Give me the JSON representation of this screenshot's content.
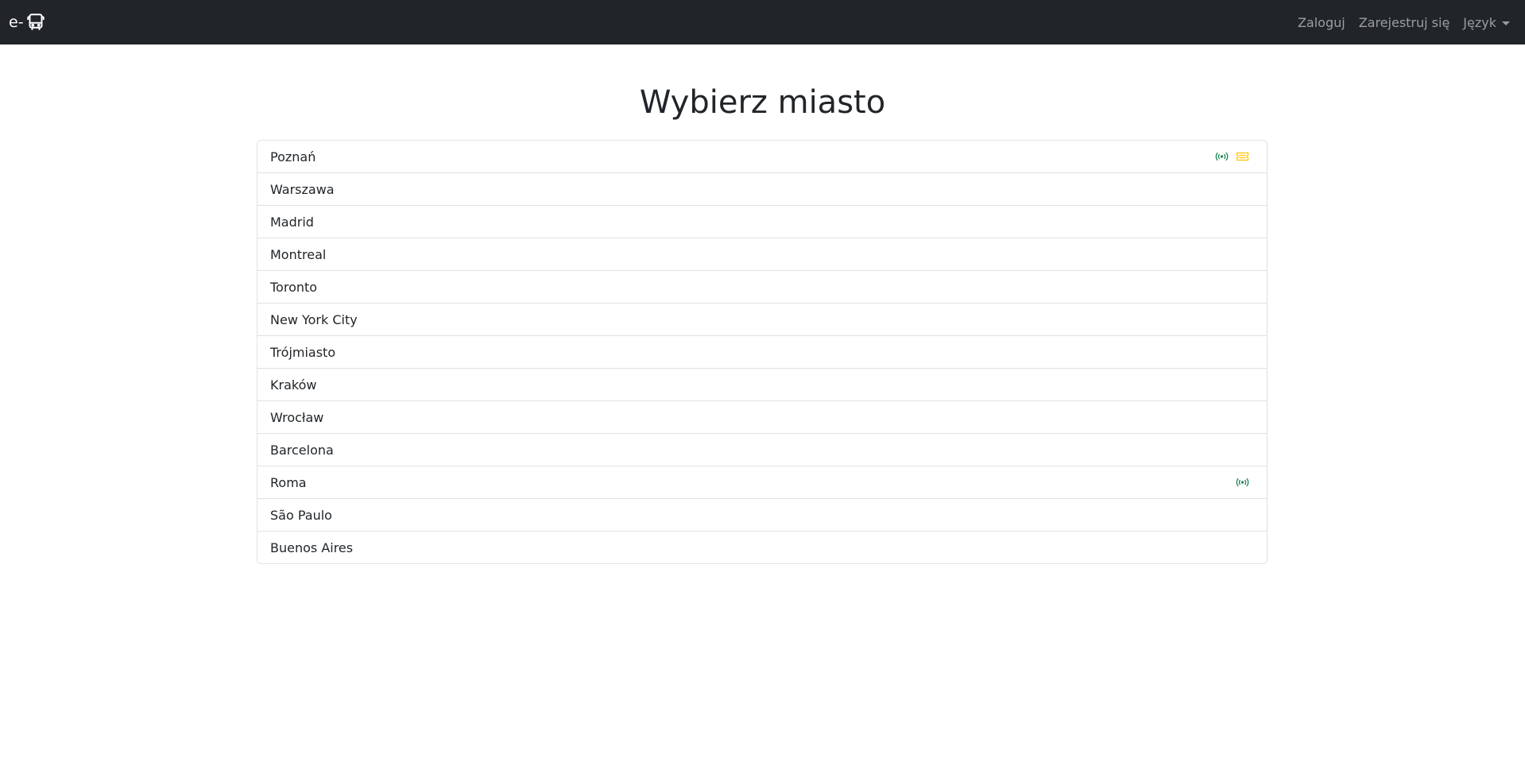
{
  "navbar": {
    "brand_text": "e-",
    "brand_icon": "bus-icon",
    "login_label": "Zaloguj",
    "register_label": "Zarejestruj się",
    "language_label": "Język"
  },
  "page": {
    "title": "Wybierz miasto"
  },
  "cities": [
    {
      "name": "Poznań",
      "icons": [
        "live-broadcast-icon",
        "ticket-icon"
      ]
    },
    {
      "name": "Warszawa",
      "icons": []
    },
    {
      "name": "Madrid",
      "icons": []
    },
    {
      "name": "Montreal",
      "icons": []
    },
    {
      "name": "Toronto",
      "icons": []
    },
    {
      "name": "New York City",
      "icons": []
    },
    {
      "name": "Trójmiasto",
      "icons": []
    },
    {
      "name": "Kraków",
      "icons": []
    },
    {
      "name": "Wrocław",
      "icons": []
    },
    {
      "name": "Barcelona",
      "icons": []
    },
    {
      "name": "Roma",
      "icons": [
        "live-broadcast-icon"
      ]
    },
    {
      "name": "São Paulo",
      "icons": []
    },
    {
      "name": "Buenos Aires",
      "icons": []
    }
  ],
  "colors": {
    "navbar_bg": "#212529",
    "live_icon": "#198754",
    "ticket_icon": "#ffc107",
    "border": "#dee2e6"
  }
}
